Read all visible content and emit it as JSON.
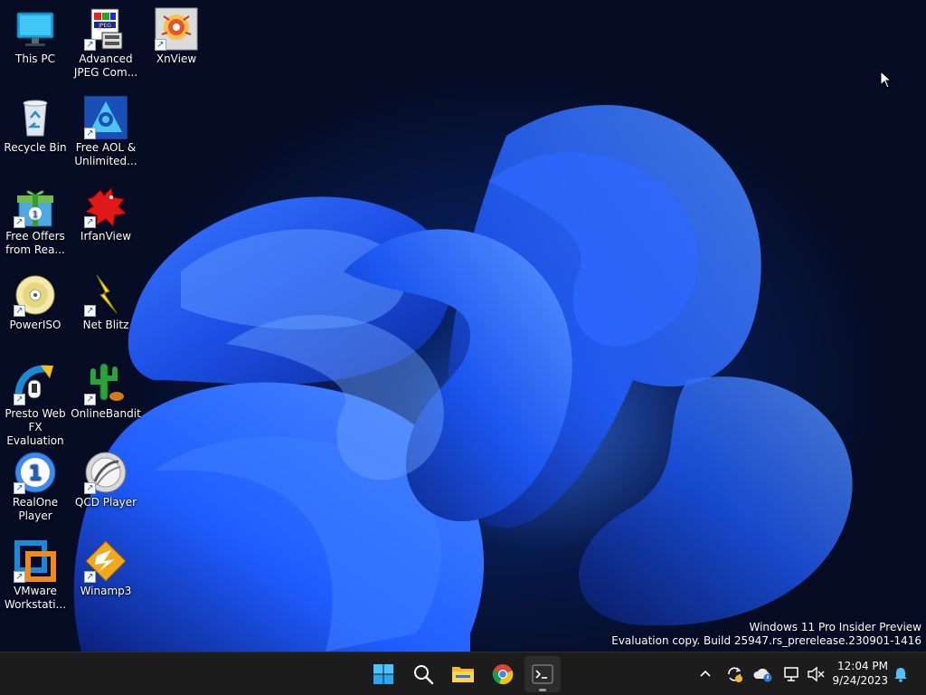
{
  "desktop_icons": [
    {
      "label": "This PC",
      "icon": "monitor-icon",
      "shortcut": false
    },
    {
      "label": "Advanced JPEG Com...",
      "icon": "jpeg-compressor-icon",
      "shortcut": true
    },
    {
      "label": "XnView",
      "icon": "xnview-icon",
      "shortcut": true
    },
    {
      "label": "Recycle Bin",
      "icon": "recycle-bin-icon",
      "shortcut": false
    },
    {
      "label": "Free AOL & Unlimited...",
      "icon": "aol-icon",
      "shortcut": true
    },
    {
      "label": "Free Offers from Rea...",
      "icon": "gift-icon",
      "shortcut": true
    },
    {
      "label": "IrfanView",
      "icon": "irfanview-icon",
      "shortcut": true
    },
    {
      "label": "PowerISO",
      "icon": "disc-icon",
      "shortcut": true
    },
    {
      "label": "Net Blitz",
      "icon": "lightning-icon",
      "shortcut": true
    },
    {
      "label": "Presto Web FX Evaluation",
      "icon": "presto-icon",
      "shortcut": true
    },
    {
      "label": "OnlineBandit",
      "icon": "cactus-icon",
      "shortcut": true
    },
    {
      "label": "RealOne Player",
      "icon": "realone-icon",
      "shortcut": true
    },
    {
      "label": "QCD Player",
      "icon": "qcd-icon",
      "shortcut": true
    },
    {
      "label": "VMware Workstati...",
      "icon": "vmware-icon",
      "shortcut": true
    },
    {
      "label": "Winamp3",
      "icon": "winamp-icon",
      "shortcut": true
    }
  ],
  "watermark": {
    "line1": "Windows 11 Pro Insider Preview",
    "line2": "Evaluation copy. Build 25947.rs_prerelease.230901-1416"
  },
  "taskbar": {
    "apps": [
      "start-icon",
      "search-icon",
      "file-explorer-icon",
      "chrome-icon",
      "terminal-icon"
    ],
    "tray": [
      "chevron-up-icon",
      "sync-icon",
      "onedrive-icon",
      "network-icon",
      "volume-muted-icon"
    ],
    "clock": {
      "time": "12:04 PM",
      "date": "9/24/2023"
    },
    "notification_icon": "bell-icon"
  },
  "colors": {
    "accent": "#1a5fd0",
    "taskbar": "#1c1c1c",
    "wallpaper_blue": "#1f5cff"
  }
}
